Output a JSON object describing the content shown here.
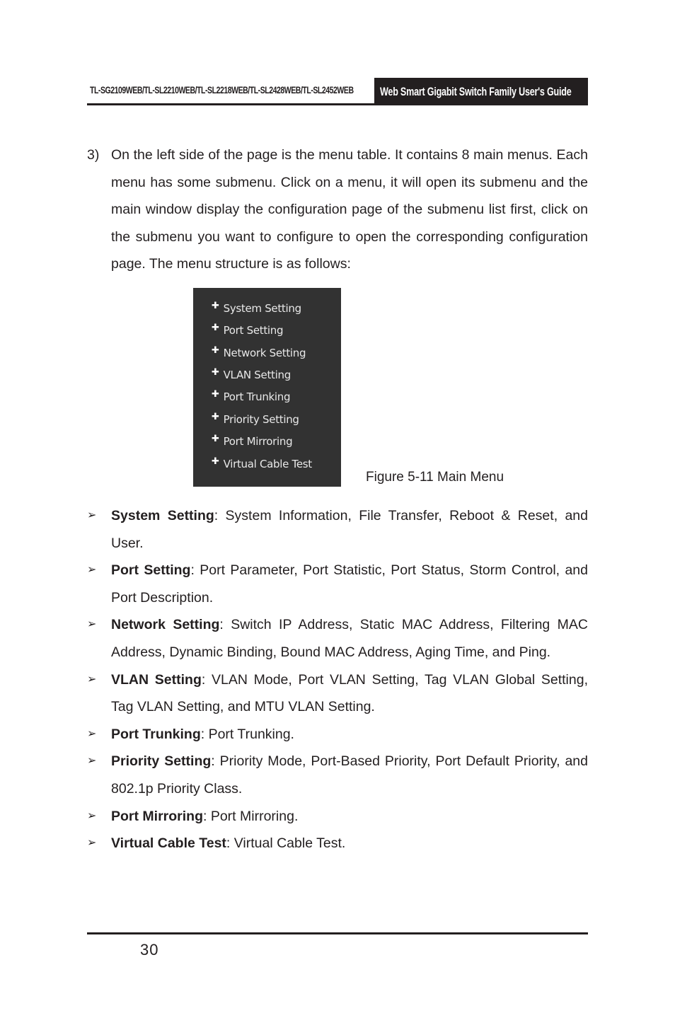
{
  "header": {
    "models": "TL-SG2109WEB/TL-SL2210WEB/TL-SL2218WEB/TL-SL2428WEB/TL-SL2452WEB",
    "title": "Web Smart Gigabit Switch Family User's Guide"
  },
  "intro": {
    "number": "3)",
    "text": "On the left side of the page is the menu table. It contains 8 main menus. Each menu has some submenu. Click on a menu, it will open its submenu and the main window display the configuration page of the submenu list first, click on the submenu you want to configure to open the corresponding configuration page. The menu structure is as follows:"
  },
  "menu_figure": {
    "bullet_icon": "plus-icon",
    "items": [
      {
        "label": "System Setting"
      },
      {
        "label": "Port Setting"
      },
      {
        "label": "Network Setting"
      },
      {
        "label": "VLAN Setting"
      },
      {
        "label": "Port Trunking"
      },
      {
        "label": "Priority Setting"
      },
      {
        "label": "Port Mirroring"
      },
      {
        "label": "Virtual Cable Test"
      }
    ],
    "caption": "Figure 5-11 Main Menu"
  },
  "descriptions": [
    {
      "term": "System Setting",
      "text": ": System Information, File Transfer, Reboot & Reset, and User."
    },
    {
      "term": "Port Setting",
      "text": ": Port Parameter, Port Statistic, Port Status, Storm Control, and Port Description."
    },
    {
      "term": "Network Setting",
      "text": ": Switch IP Address, Static MAC Address, Filtering MAC Address, Dynamic Binding, Bound MAC Address, Aging Time, and Ping."
    },
    {
      "term": "VLAN Setting",
      "text": ": VLAN Mode, Port VLAN Setting, Tag VLAN Global Setting, Tag VLAN Setting, and MTU VLAN Setting."
    },
    {
      "term": "Port Trunking",
      "text": ": Port Trunking."
    },
    {
      "term": "Priority Setting",
      "text": ": Priority Mode, Port-Based Priority, Port Default Priority, and 802.1p Priority Class."
    },
    {
      "term": "Port Mirroring",
      "text": ": Port Mirroring."
    },
    {
      "term": "Virtual Cable Test",
      "text": ": Virtual Cable Test."
    }
  ],
  "bullet_glyph": "➢",
  "footer": {
    "page_number": "30"
  }
}
